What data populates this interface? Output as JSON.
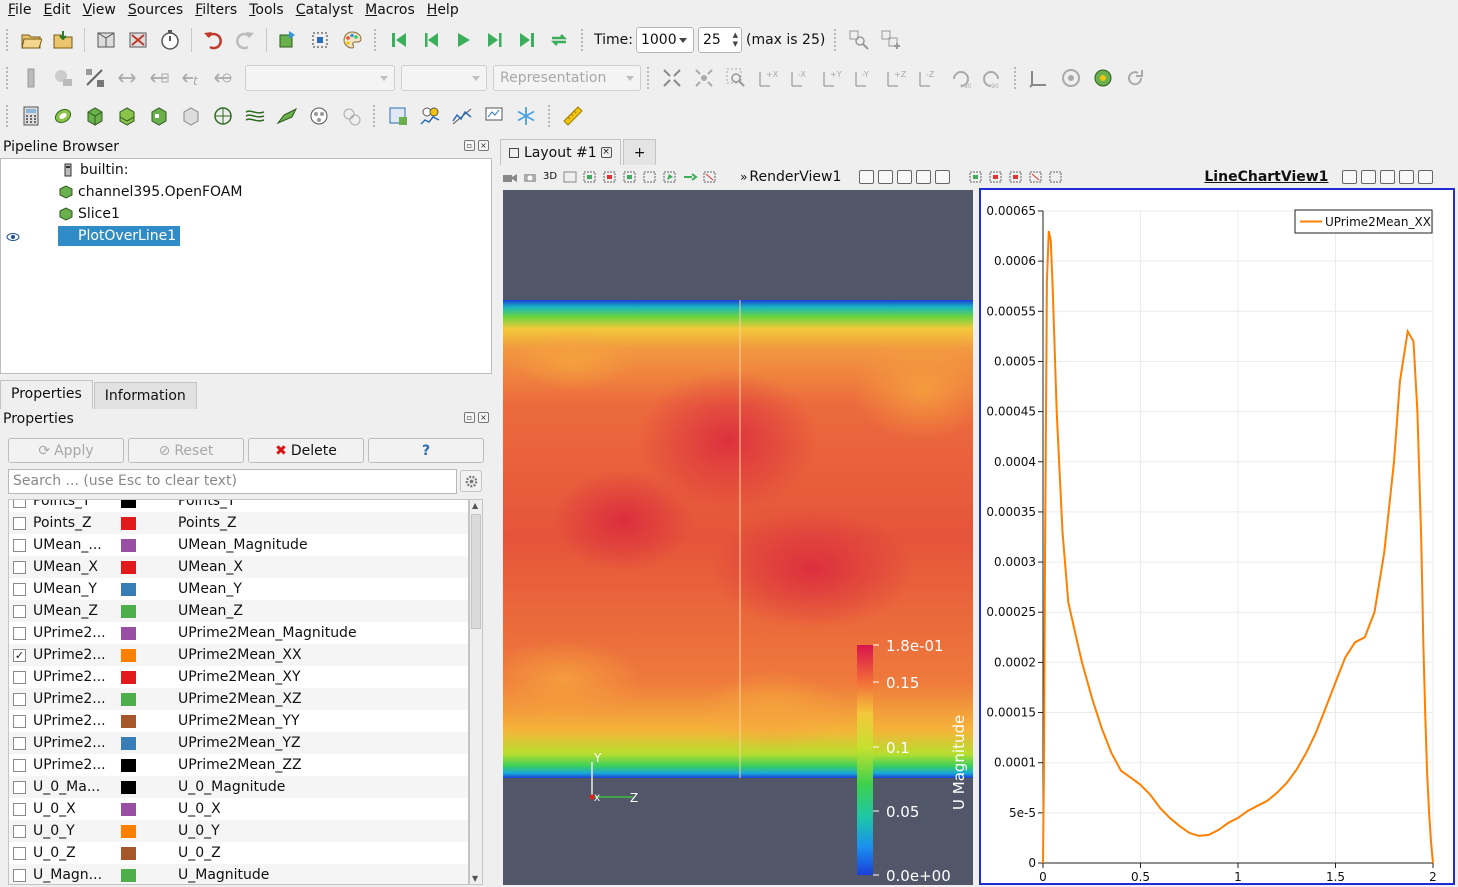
{
  "menubar": [
    {
      "label": "File",
      "u": "F",
      "rest": "ile"
    },
    {
      "label": "Edit",
      "u": "E",
      "rest": "dit"
    },
    {
      "label": "View",
      "u": "V",
      "rest": "iew"
    },
    {
      "label": "Sources",
      "u": "S",
      "rest": "ources"
    },
    {
      "label": "Filters",
      "u": "F",
      "rest": "ilters"
    },
    {
      "label": "Tools",
      "u": "T",
      "rest": "ools"
    },
    {
      "label": "Catalyst",
      "u": "C",
      "rest": "atalyst"
    },
    {
      "label": "Macros",
      "u": "M",
      "rest": "acros"
    },
    {
      "label": "Help",
      "u": "H",
      "rest": "elp"
    }
  ],
  "time": {
    "label": "Time:",
    "value": "1000",
    "step": "25",
    "max_text": "(max is 25)"
  },
  "representation": {
    "placeholder": "Representation"
  },
  "pipeline": {
    "title": "Pipeline Browser",
    "items": [
      {
        "name": "builtin:"
      },
      {
        "name": "channel395.OpenFOAM"
      },
      {
        "name": "Slice1"
      },
      {
        "name": "PlotOverLine1"
      }
    ]
  },
  "properties": {
    "tab_properties": "Properties",
    "tab_information": "Information",
    "title": "Properties",
    "apply": "Apply",
    "reset": "Reset",
    "delete": "Delete",
    "help": "?",
    "search_placeholder": "Search ... (use Esc to clear text)",
    "arrays": [
      {
        "short": "Points_Y",
        "full": "Points_Y",
        "color": "#000000",
        "checked": false
      },
      {
        "short": "Points_Z",
        "full": "Points_Z",
        "color": "#e31a1c",
        "checked": false
      },
      {
        "short": "UMean_...",
        "full": "UMean_Magnitude",
        "color": "#984ea3",
        "checked": false
      },
      {
        "short": "UMean_X",
        "full": "UMean_X",
        "color": "#e31a1c",
        "checked": false
      },
      {
        "short": "UMean_Y",
        "full": "UMean_Y",
        "color": "#377eb8",
        "checked": false
      },
      {
        "short": "UMean_Z",
        "full": "UMean_Z",
        "color": "#4daf4a",
        "checked": false
      },
      {
        "short": "UPrime2...",
        "full": "UPrime2Mean_Magnitude",
        "color": "#984ea3",
        "checked": false
      },
      {
        "short": "UPrime2...",
        "full": "UPrime2Mean_XX",
        "color": "#ff7f00",
        "checked": true
      },
      {
        "short": "UPrime2...",
        "full": "UPrime2Mean_XY",
        "color": "#e31a1c",
        "checked": false
      },
      {
        "short": "UPrime2...",
        "full": "UPrime2Mean_XZ",
        "color": "#4daf4a",
        "checked": false
      },
      {
        "short": "UPrime2...",
        "full": "UPrime2Mean_YY",
        "color": "#a65628",
        "checked": false
      },
      {
        "short": "UPrime2...",
        "full": "UPrime2Mean_YZ",
        "color": "#377eb8",
        "checked": false
      },
      {
        "short": "UPrime2...",
        "full": "UPrime2Mean_ZZ",
        "color": "#000000",
        "checked": false
      },
      {
        "short": "U_0_Ma...",
        "full": "U_0_Magnitude",
        "color": "#000000",
        "checked": false
      },
      {
        "short": "U_0_X",
        "full": "U_0_X",
        "color": "#984ea3",
        "checked": false
      },
      {
        "short": "U_0_Y",
        "full": "U_0_Y",
        "color": "#ff7f00",
        "checked": false
      },
      {
        "short": "U_0_Z",
        "full": "U_0_Z",
        "color": "#a65628",
        "checked": false
      },
      {
        "short": "U_Magn...",
        "full": "U_Magnitude",
        "color": "#4daf4a",
        "checked": false
      }
    ]
  },
  "layout": {
    "tab_label": "Layout #1",
    "add_tab": "+",
    "render_view": "RenderView1",
    "render_3d": "3D",
    "chart_view": "LineChartView1"
  },
  "render": {
    "colorbar_title": "U Magnitude",
    "colorbar_ticks": [
      "1.8e-01",
      "0.15",
      "0.1",
      "0.05",
      "0.0e+00"
    ],
    "axes": {
      "y": "Y",
      "x": "X",
      "z": "Z"
    }
  },
  "chart_data": {
    "type": "line",
    "title": "",
    "xlabel": "",
    "ylabel": "",
    "xlim": [
      0,
      2
    ],
    "ylim": [
      0,
      0.00065
    ],
    "x_ticks": [
      "0",
      "0.5",
      "1",
      "1.5",
      "2"
    ],
    "y_ticks": [
      "0",
      "5e-5",
      "0.0001",
      "0.00015",
      "0.0002",
      "0.00025",
      "0.0003",
      "0.00035",
      "0.0004",
      "0.00045",
      "0.0005",
      "0.00055",
      "0.0006",
      "0.00065"
    ],
    "legend": "top-right",
    "grid": true,
    "series": [
      {
        "name": "UPrime2Mean_XX",
        "color": "#ff7f00",
        "x": [
          0,
          0.005,
          0.01,
          0.02,
          0.03,
          0.04,
          0.05,
          0.07,
          0.1,
          0.13,
          0.17,
          0.2,
          0.25,
          0.3,
          0.35,
          0.4,
          0.45,
          0.5,
          0.55,
          0.6,
          0.65,
          0.7,
          0.75,
          0.8,
          0.85,
          0.9,
          0.95,
          1.0,
          1.05,
          1.1,
          1.15,
          1.2,
          1.25,
          1.3,
          1.35,
          1.4,
          1.45,
          1.5,
          1.55,
          1.6,
          1.65,
          1.7,
          1.75,
          1.8,
          1.83,
          1.87,
          1.9,
          1.92,
          1.94,
          1.95,
          1.96,
          1.97,
          1.98,
          1.99,
          1.995,
          2.0
        ],
        "y": [
          0,
          0.0001,
          0.0003,
          0.00058,
          0.00063,
          0.00062,
          0.00057,
          0.00045,
          0.00033,
          0.00026,
          0.000225,
          0.0002,
          0.000165,
          0.000135,
          0.00011,
          9.2e-05,
          8.5e-05,
          7.8e-05,
          6.8e-05,
          5.5e-05,
          4.5e-05,
          3.7e-05,
          3e-05,
          2.7e-05,
          2.8e-05,
          3.3e-05,
          4e-05,
          4.5e-05,
          5.2e-05,
          5.7e-05,
          6.2e-05,
          7e-05,
          8e-05,
          9.3e-05,
          0.00011,
          0.00013,
          0.000155,
          0.00018,
          0.000205,
          0.00022,
          0.000225,
          0.00025,
          0.00031,
          0.0004,
          0.00048,
          0.00053,
          0.00052,
          0.00045,
          0.00032,
          0.00022,
          0.00015,
          9e-05,
          5e-05,
          2e-05,
          1e-05,
          0
        ]
      }
    ]
  }
}
